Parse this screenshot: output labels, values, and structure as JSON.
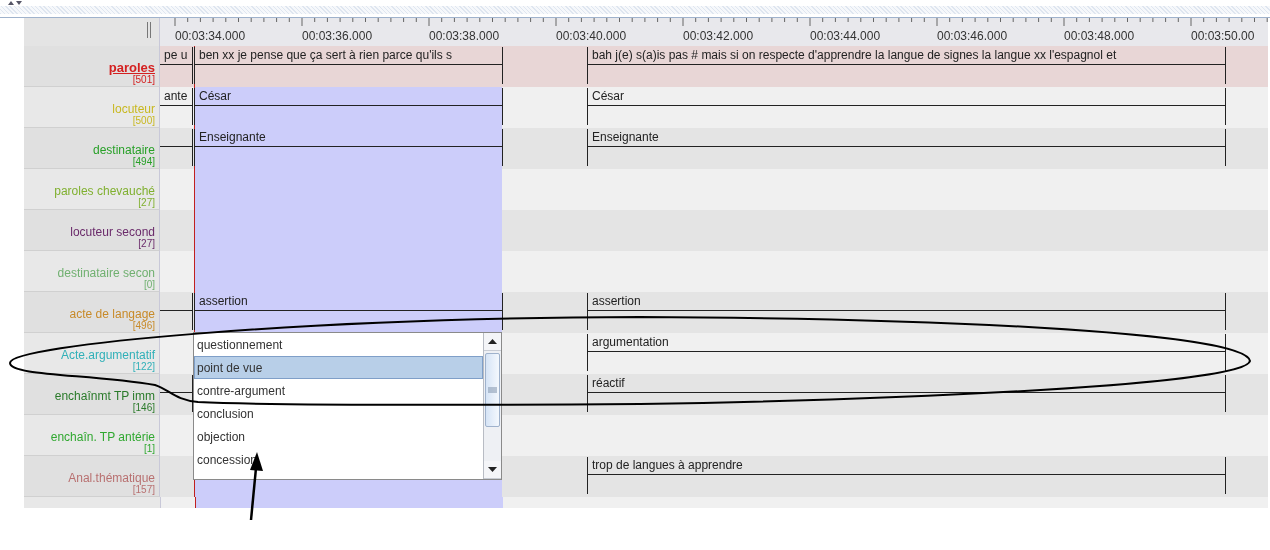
{
  "ruler": {
    "ticks": [
      "00:03:34.000",
      "00:03:36.000",
      "00:03:38.000",
      "00:03:40.000",
      "00:03:42.000",
      "00:03:44.000",
      "00:03:46.000",
      "00:03:48.000",
      "00:03:50.00"
    ]
  },
  "tiers": [
    {
      "name": "paroles",
      "count": "[501]",
      "color": "#d42020",
      "active": true,
      "annotations": [
        {
          "kind": "tail",
          "text": "pe u"
        },
        {
          "kind": "current",
          "text": "ben xx je pense que ça sert à rien parce qu'ils s"
        },
        {
          "kind": "next",
          "text": "bah j(e) s(a)is pas # mais si on respecte d'apprendre la langue de signes la langue xx l'espagnol et"
        }
      ]
    },
    {
      "name": "locuteur",
      "count": "[500]",
      "color": "#c8b820",
      "active": false,
      "annotations": [
        {
          "kind": "tail",
          "text": "ante"
        },
        {
          "kind": "current",
          "text": "César"
        },
        {
          "kind": "next",
          "text": "César"
        }
      ]
    },
    {
      "name": "destinataire",
      "count": "[494]",
      "color": "#28a028",
      "active": false,
      "annotations": [
        {
          "kind": "tail"
        },
        {
          "kind": "current",
          "text": "Enseignante"
        },
        {
          "kind": "next",
          "text": "Enseignante"
        }
      ]
    },
    {
      "name": "paroles chevauché",
      "count": "[27]",
      "color": "#80b030",
      "active": false
    },
    {
      "name": "locuteur second",
      "count": "[27]",
      "color": "#6a2a6a",
      "active": false
    },
    {
      "name": "destinataire secon",
      "count": "[0]",
      "color": "#70b070",
      "active": false
    },
    {
      "name": "acte de langage",
      "count": "[496]",
      "color": "#c88a28",
      "active": false,
      "annotations": [
        {
          "kind": "tail"
        },
        {
          "kind": "current",
          "text": "assertion"
        },
        {
          "kind": "next",
          "text": "assertion"
        }
      ]
    },
    {
      "name": "Acte.argumentatif",
      "count": "[122]",
      "color": "#30b0b8",
      "active": false,
      "annotations": [
        {
          "kind": "next",
          "text": "argumentation"
        }
      ]
    },
    {
      "name": "enchaînmt TP imm",
      "count": "[146]",
      "color": "#2a7a2a",
      "active": false,
      "annotations": [
        {
          "kind": "tail"
        },
        {
          "kind": "next",
          "text": "réactif"
        }
      ]
    },
    {
      "name": "enchaîn. TP antérie",
      "count": "[1]",
      "color": "#30a830",
      "active": false
    },
    {
      "name": "Anal.thématique",
      "count": "[157]",
      "color": "#b87070",
      "active": false,
      "annotations": [
        {
          "kind": "next",
          "text": "trop de langues à apprendre"
        }
      ]
    }
  ],
  "dropdown": {
    "items": [
      {
        "label": "questionnement",
        "selected": false
      },
      {
        "label": "point de vue",
        "selected": true
      },
      {
        "label": "contre-argument",
        "selected": false
      },
      {
        "label": "conclusion",
        "selected": false
      },
      {
        "label": "objection",
        "selected": false
      },
      {
        "label": "concession",
        "selected": false
      }
    ]
  }
}
